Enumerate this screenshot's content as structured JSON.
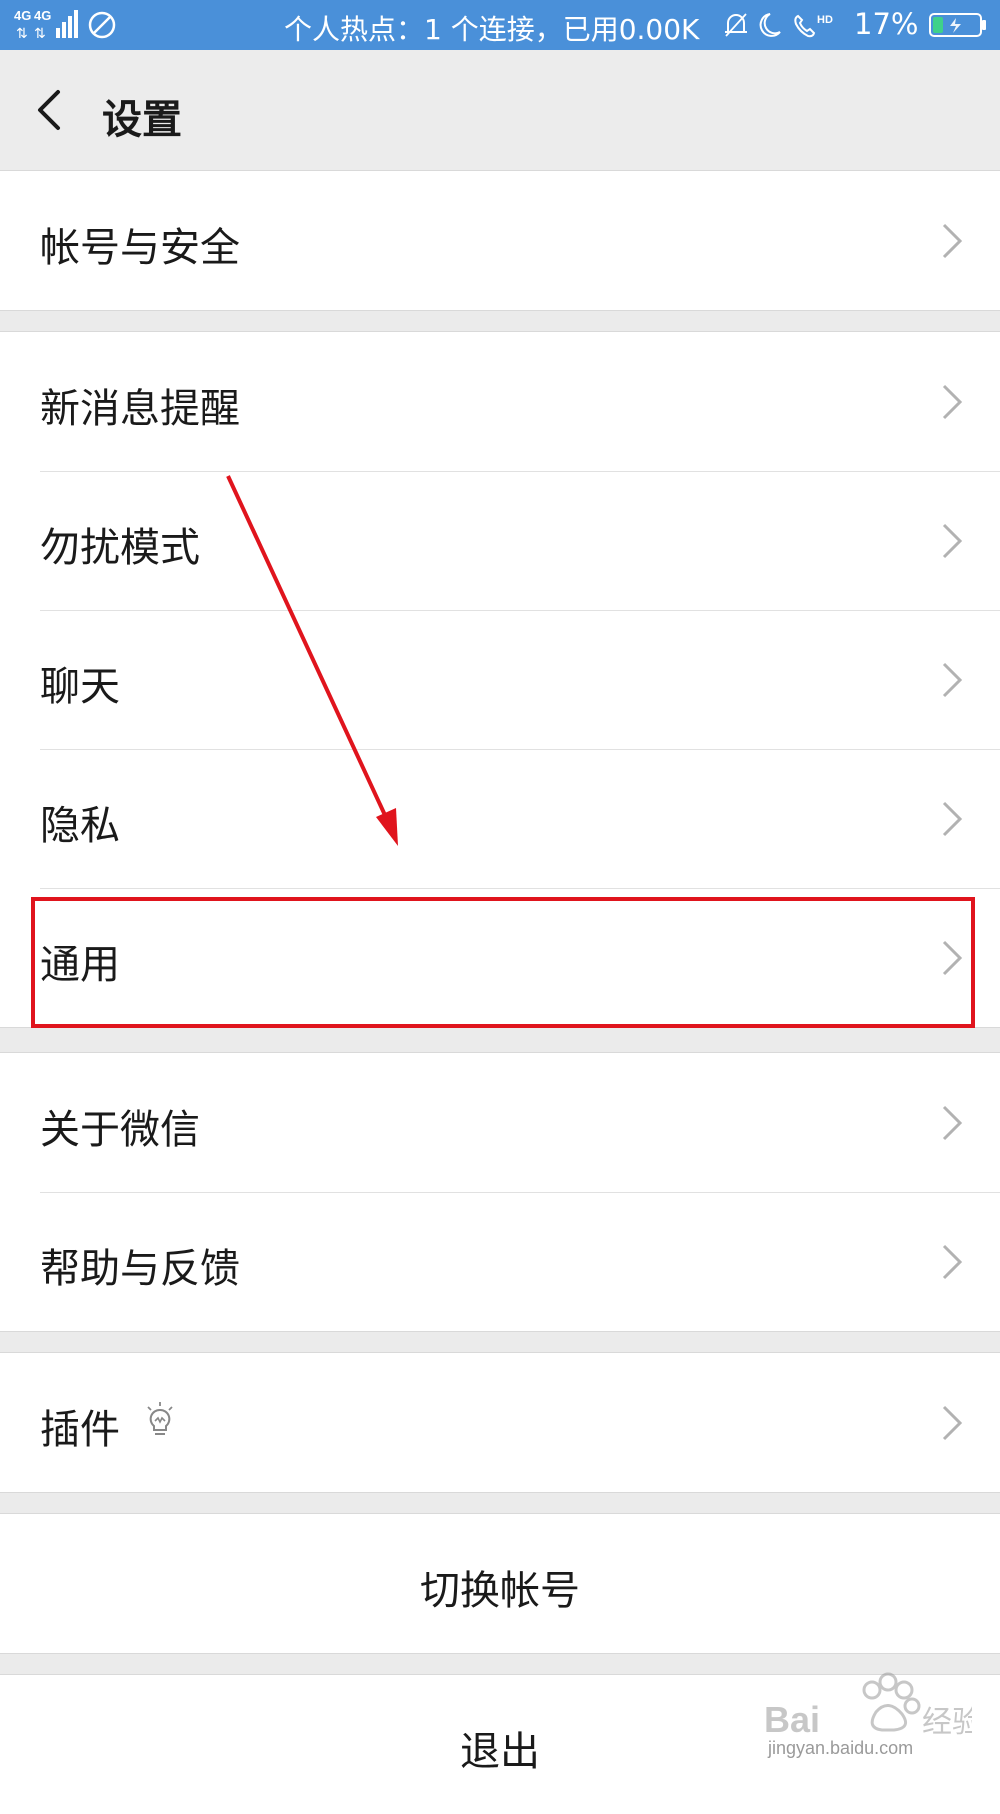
{
  "status_bar": {
    "network": "4G 4G",
    "hotspot": "个人热点：1 个连接，已用0.00K",
    "battery_percent": "17%",
    "background_color": "#4a90d9",
    "icons": [
      "signal-icon",
      "blocked-icon",
      "alarm-icon",
      "moon-icon",
      "hd-call-icon",
      "battery-icon"
    ]
  },
  "nav": {
    "title": "设置"
  },
  "groups": [
    {
      "items": [
        {
          "label": "帐号与安全"
        }
      ]
    },
    {
      "items": [
        {
          "label": "新消息提醒"
        },
        {
          "label": "勿扰模式"
        },
        {
          "label": "聊天"
        },
        {
          "label": "隐私"
        },
        {
          "label": "通用"
        }
      ]
    },
    {
      "items": [
        {
          "label": "关于微信"
        },
        {
          "label": "帮助与反馈"
        }
      ]
    },
    {
      "items": [
        {
          "label": "插件",
          "icon": "lightbulb-icon"
        }
      ]
    }
  ],
  "actions": {
    "switch_account": "切换帐号",
    "logout": "退出"
  },
  "annotation": {
    "highlight_color": "#e0141d",
    "highlighted_item": "通用"
  },
  "watermark": {
    "brand": "Baidu经验",
    "url": "jingyan.baidu.com"
  }
}
